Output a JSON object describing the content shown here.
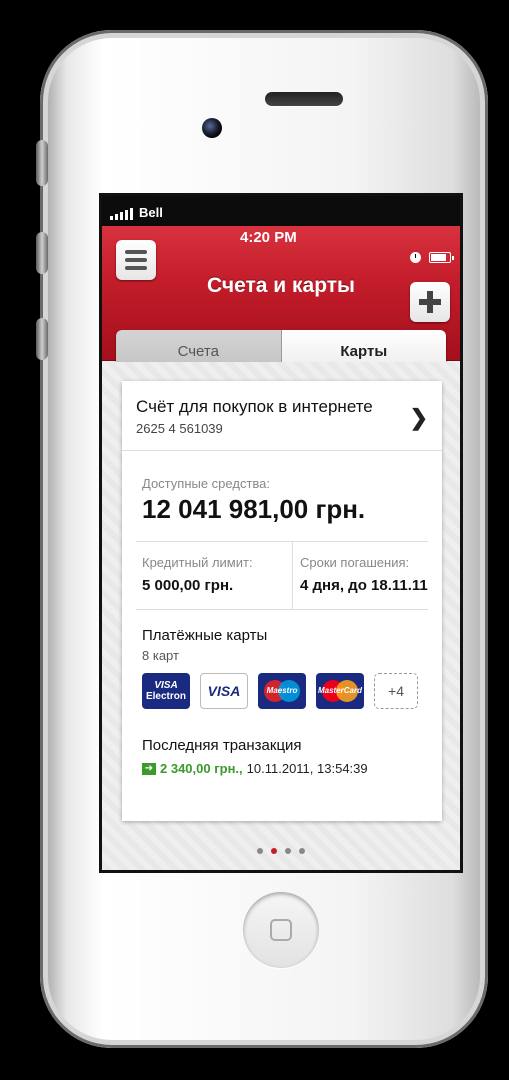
{
  "status_bar": {
    "carrier": "Bell",
    "time": "4:20 PM"
  },
  "nav": {
    "title": "Счета и карты"
  },
  "tabs": [
    {
      "label": "Счета",
      "selected": false
    },
    {
      "label": "Карты",
      "selected": true
    }
  ],
  "account": {
    "name": "Счёт для покупок в интернете",
    "number": "2625 4 561039",
    "available_label": "Доступные средства:",
    "available_value": "12 041 981,00 грн.",
    "credit_label": "Кредитный лимит:",
    "credit_value": "5 000,00 грн.",
    "term_label": "Сроки погашения:",
    "term_value": "4 дня, до 18.11.11"
  },
  "payment_cards": {
    "title": "Платёжные карты",
    "count": "8 карт",
    "logos": {
      "visa_electron_1": "VISA",
      "visa_electron_2": "Electron",
      "visa": "VISA",
      "maestro": "Maestro",
      "mastercard": "MasterCard"
    },
    "more": "+4"
  },
  "last_transaction": {
    "title": "Последняя транзакция",
    "amount": "2 340,00 грн.,",
    "datetime": "10.11.2011, 13:54:39"
  },
  "colors": {
    "accent": "#c41d2b",
    "positive": "#3a9a2a",
    "card_brand": "#1a2a80"
  }
}
